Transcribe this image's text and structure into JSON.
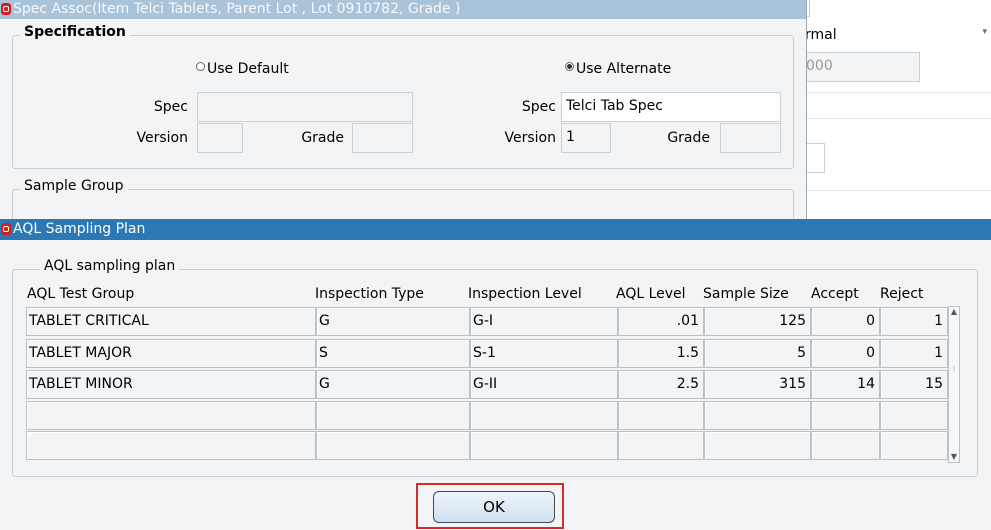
{
  "background_form": {
    "combo_value": "rmal",
    "field_value": "000"
  },
  "spec_window": {
    "title": "Spec Assoc(Item Telci Tablets, Parent Lot , Lot 0910782, Grade )",
    "specification_label": "Specification",
    "use_default_label": "Use Default",
    "use_alternate_label": "Use Alternate",
    "default": {
      "spec_label": "Spec",
      "spec_value": "",
      "version_label": "Version",
      "version_value": "",
      "grade_label": "Grade",
      "grade_value": ""
    },
    "alternate": {
      "spec_label": "Spec",
      "spec_value": "Telci Tab Spec",
      "version_label": "Version",
      "version_value": "1",
      "grade_label": "Grade",
      "grade_value": ""
    },
    "sample_group_label": "Sample Group"
  },
  "aql_window": {
    "title": "AQL Sampling Plan",
    "group_label": "AQL sampling plan",
    "columns": [
      "AQL Test Group",
      "Inspection Type",
      "Inspection Level",
      "AQL Level",
      "Sample Size",
      "Accept",
      "Reject"
    ],
    "rows": [
      [
        "TABLET CRITICAL",
        "G",
        "G-I",
        ".01",
        "125",
        "0",
        "1"
      ],
      [
        "TABLET MAJOR",
        "S",
        "S-1",
        "1.5",
        "5",
        "0",
        "1"
      ],
      [
        "TABLET MINOR",
        "G",
        "G-II",
        "2.5",
        "315",
        "14",
        "15"
      ],
      [
        "",
        "",
        "",
        "",
        "",
        "",
        ""
      ],
      [
        "",
        "",
        "",
        "",
        "",
        "",
        ""
      ]
    ],
    "ok_label": "OK"
  }
}
